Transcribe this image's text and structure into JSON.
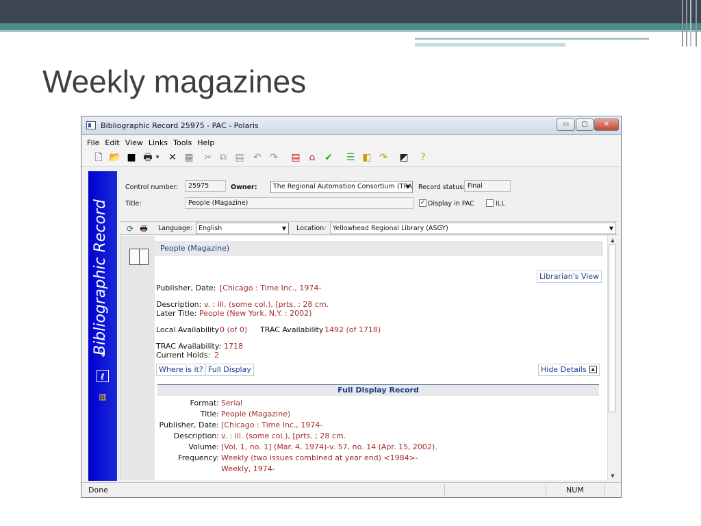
{
  "slide": {
    "title": "Weekly magazines"
  },
  "window": {
    "title": "Bibliographic Record 25975 - PAC -  Polaris",
    "controls": {
      "minimize": "▭",
      "maximize": "▢",
      "close": "✕"
    }
  },
  "menu": [
    "File",
    "Edit",
    "View",
    "Links",
    "Tools",
    "Help"
  ],
  "toolbar_icons": [
    "new-icon",
    "open-icon",
    "save-icon",
    "print-icon",
    "dropdown-icon",
    "delete-icon",
    "bulk-icon",
    "cut-icon",
    "copy-icon",
    "paste-icon",
    "undo-icon",
    "redo-icon",
    "marc-icon",
    "record-icon",
    "check-icon",
    "list-icon",
    "item-icon",
    "link-icon",
    "properties-icon",
    "help-icon"
  ],
  "sidebar": {
    "label": "Bibliographic Record"
  },
  "form": {
    "control_number_label": "Control number:",
    "control_number": "25975",
    "owner_label": "Owner:",
    "owner": "The Regional Automation Consortium (TRAC)",
    "record_status_label": "Record status:",
    "record_status": "Final",
    "title_label": "Title:",
    "title": "People (Magazine)",
    "display_in_pac_label": "Display in PAC",
    "display_in_pac_checked": true,
    "ill_label": "ILL",
    "ill_checked": false
  },
  "langbar": {
    "language_label": "Language:",
    "language": "English",
    "location_label": "Location:",
    "location": "Yellowhead Regional Library (ASGY)"
  },
  "record": {
    "heading": "People (Magazine)",
    "librarians_view": "Librarian's View",
    "publisher_label": "Publisher, Date:",
    "publisher_value": "[Chicago : Time Inc., 1974-",
    "description_label": "Description:",
    "description_value": "v. : ill. (some col.), [prts. ; 28 cm.",
    "later_title_label": "Later Title:",
    "later_title_value": "People (New York, N.Y. : 2002)",
    "local_avail_label": "Local Availability",
    "local_avail_value": "0 (of 0)",
    "trac_avail_label": "TRAC Availability",
    "trac_avail_value": "1492 (of 1718)",
    "trac_avail2_label": "TRAC Availability:",
    "trac_avail2_value": "1718",
    "current_holds_label": "Current Holds:",
    "current_holds_value": "2",
    "where_is_it": "Where is it?",
    "full_display": "Full Display",
    "hide_details": "Hide Details"
  },
  "full_display": {
    "heading": "Full Display Record",
    "rows": [
      {
        "label": "Format:",
        "value": "Serial"
      },
      {
        "label": "Title:",
        "value": "People (Magazine)"
      },
      {
        "label": "Publisher, Date:",
        "value": "[Chicago : Time Inc., 1974-"
      },
      {
        "label": "Description:",
        "value": "v. : ill. (some col.), [prts. ; 28 cm."
      },
      {
        "label": "Volume:",
        "value": "[Vol. 1, no. 1] (Mar. 4, 1974)-v. 57, no. 14 (Apr. 15, 2002)."
      },
      {
        "label": "Frequency:",
        "value": "Weekly (two issues combined at year end) <1984>-"
      },
      {
        "label": "",
        "value": "Weekly, 1974-"
      }
    ]
  },
  "status": {
    "left": "Done",
    "num": "NUM"
  }
}
